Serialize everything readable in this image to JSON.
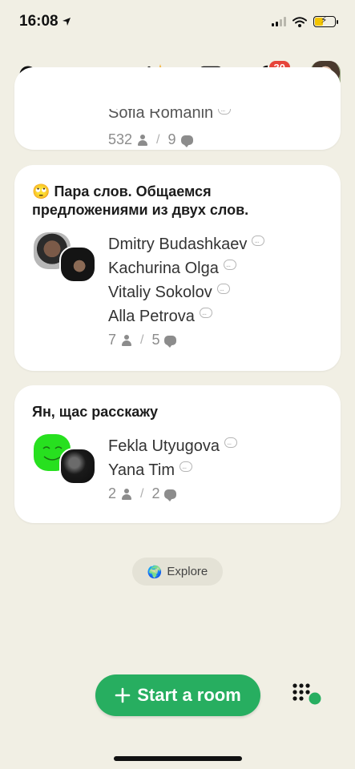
{
  "status_bar": {
    "time": "16:08"
  },
  "top_bar": {
    "notification_count": "30"
  },
  "feed": {
    "top_card": {
      "partial_name": "Sofia Romanin",
      "participants": "532",
      "speakers": "9"
    },
    "rooms": [
      {
        "emoji": "🙄",
        "title": "Пара слов. Общаемся предложениями из двух слов.",
        "speakers": [
          "Dmitry Budashkaev",
          "Kachurina Olga",
          "Vitaliy Sokolov",
          "Alla Petrova"
        ],
        "participants": "7",
        "speaker_count": "5"
      },
      {
        "title": "Ян, щас расскажу",
        "speakers": [
          "Fekla Utyugova",
          "Yana Tim"
        ],
        "participants": "2",
        "speaker_count": "2"
      }
    ]
  },
  "explore": {
    "emoji": "🌍",
    "label": "Explore"
  },
  "start_room": {
    "label": "Start a room"
  },
  "colors": {
    "background": "#f1efe4",
    "accent_green": "#27ae60",
    "badge_red": "#e6443a"
  }
}
